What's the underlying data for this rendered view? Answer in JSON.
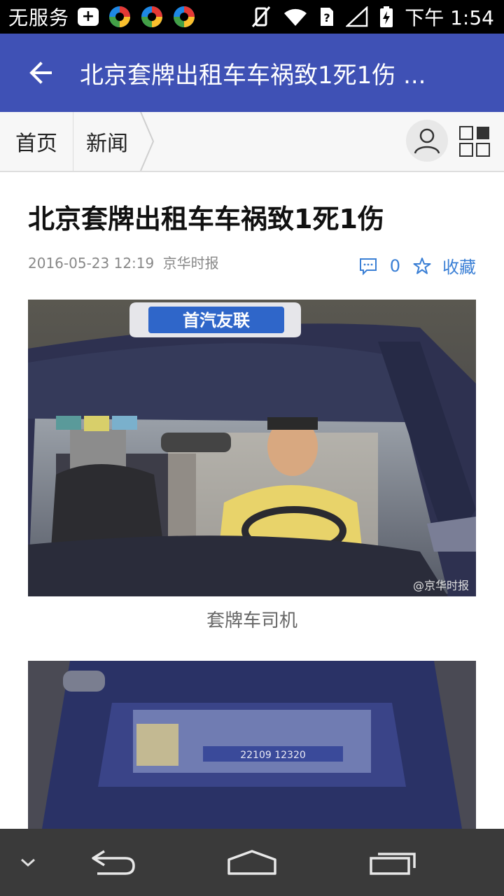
{
  "status_bar": {
    "carrier": "无服务",
    "time": "下午 1:54"
  },
  "header": {
    "title": "北京套牌出租车车祸致1死1伤 ..."
  },
  "breadcrumb": {
    "home": "首页",
    "current": "新闻"
  },
  "article": {
    "title": "北京套牌出租车车祸致1死1伤",
    "date": "2016-05-23 12:19",
    "source": "京华时报",
    "comment_count": "0",
    "favorite_label": "收藏",
    "images": [
      {
        "caption": "套牌车司机",
        "roof_sign": "首汽友联",
        "watermark": "@京华时报"
      },
      {
        "caption": "",
        "plate_text": "22109 12320"
      }
    ]
  },
  "colors": {
    "header_bg": "#3f51b5",
    "accent": "#3a7fd5",
    "navbar_bg": "#3a3a3a"
  }
}
